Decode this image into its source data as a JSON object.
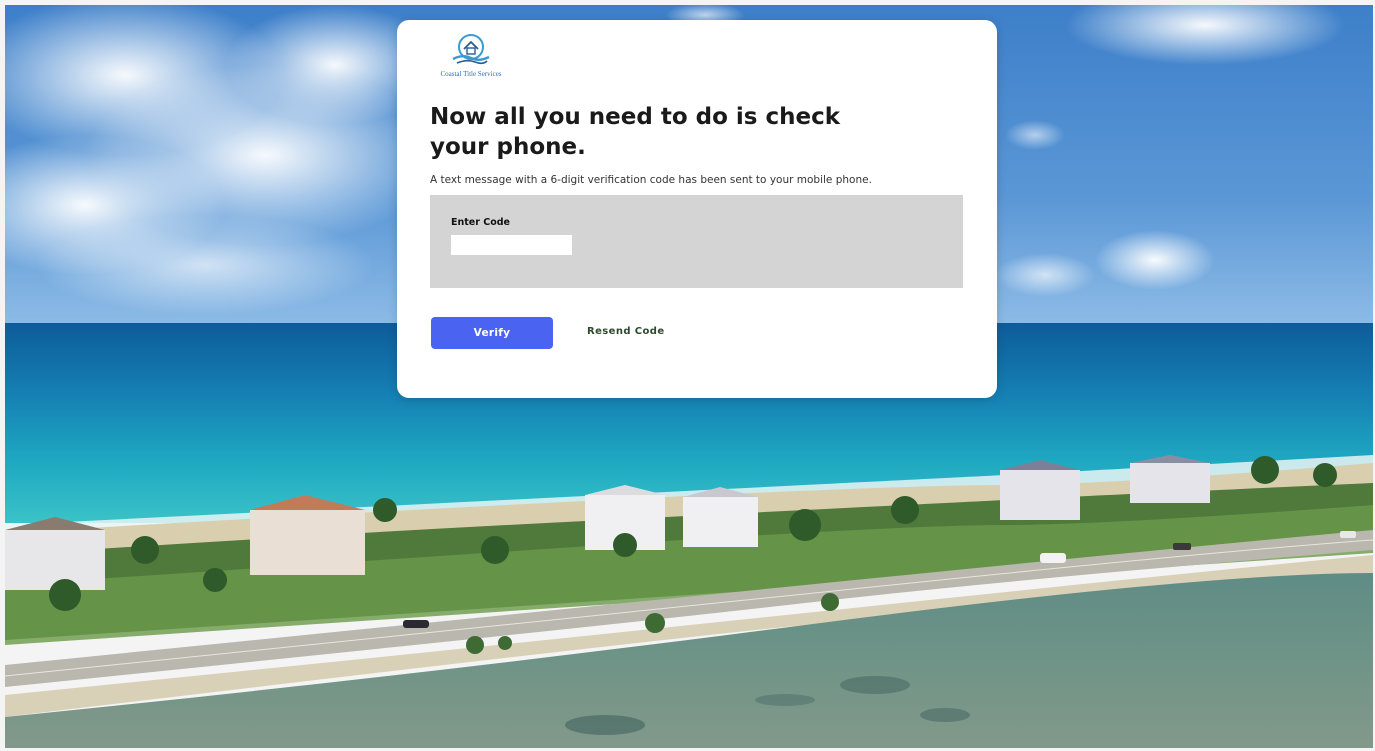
{
  "brand": {
    "logo_icon": "house-wave-logo-icon",
    "name": "Coastal Title Services"
  },
  "verification": {
    "heading": "Now all you need to do is check your phone.",
    "message": "A text message with a 6-digit verification code has been sent to your mobile phone.",
    "code_label": "Enter Code",
    "code_value": "",
    "code_placeholder": ""
  },
  "actions": {
    "verify_label": "Verify",
    "resend_label": "Resend Code"
  },
  "colors": {
    "primary_button": "#4a63f0",
    "code_panel": "#d4d4d4",
    "card": "#ffffff"
  }
}
